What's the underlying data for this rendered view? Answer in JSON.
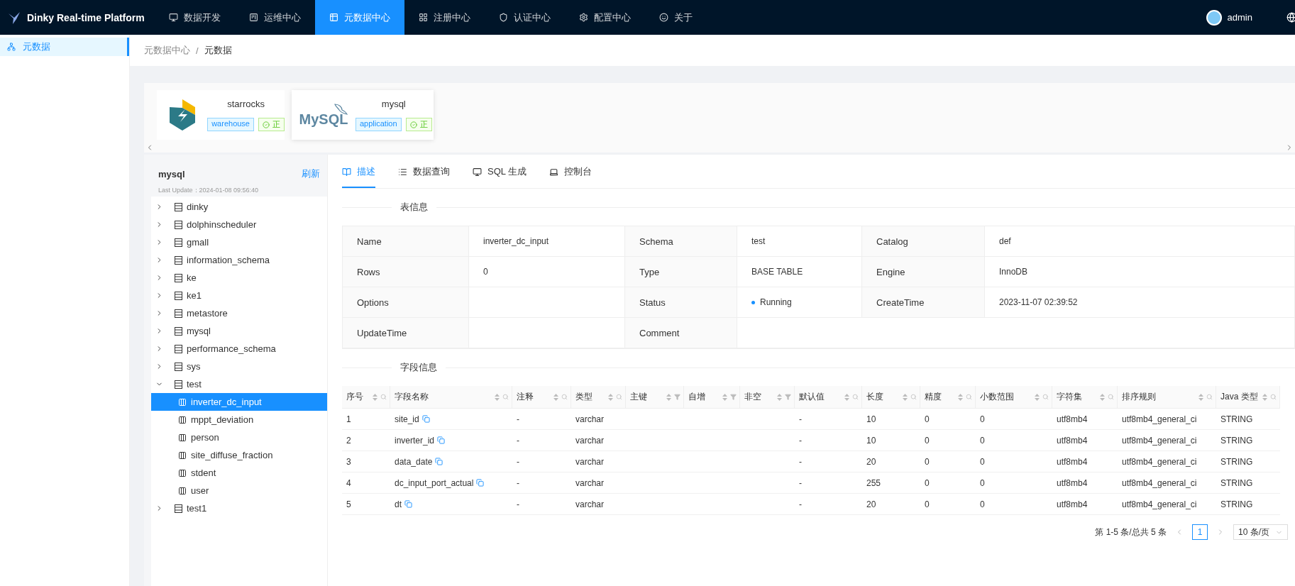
{
  "header": {
    "title": "Dinky Real-time Platform",
    "user": "admin",
    "nav": [
      {
        "label": "数据开发",
        "selected": false
      },
      {
        "label": "运维中心",
        "selected": false
      },
      {
        "label": "元数据中心",
        "selected": true
      },
      {
        "label": "注册中心",
        "selected": false
      },
      {
        "label": "认证中心",
        "selected": false
      },
      {
        "label": "配置中心",
        "selected": false
      },
      {
        "label": "关于",
        "selected": false
      }
    ]
  },
  "sidebar": {
    "items": [
      {
        "label": "元数据",
        "selected": true
      }
    ]
  },
  "breadcrumb": {
    "items": [
      "元数据中心",
      "元数据"
    ],
    "separator": "/"
  },
  "datasources": [
    {
      "name": "starrocks",
      "tag": "warehouse",
      "status": "正",
      "selected": false
    },
    {
      "name": "mysql",
      "logo_text": "MySQL",
      "tag": "application",
      "status": "正",
      "selected": true
    }
  ],
  "tree": {
    "title": "mysql",
    "refresh": "刷新",
    "last_update": "Last Update：2024-01-08 09:56:40",
    "items": [
      {
        "label": "dinky",
        "expanded": false
      },
      {
        "label": "dolphinscheduler",
        "expanded": false
      },
      {
        "label": "gmall",
        "expanded": false
      },
      {
        "label": "information_schema",
        "expanded": false
      },
      {
        "label": "ke",
        "expanded": false
      },
      {
        "label": "ke1",
        "expanded": false
      },
      {
        "label": "metastore",
        "expanded": false
      },
      {
        "label": "mysql",
        "expanded": false
      },
      {
        "label": "performance_schema",
        "expanded": false
      },
      {
        "label": "sys",
        "expanded": false
      },
      {
        "label": "test",
        "expanded": true,
        "children": [
          {
            "label": "inverter_dc_input",
            "selected": true
          },
          {
            "label": "mppt_deviation",
            "selected": false
          },
          {
            "label": "person",
            "selected": false
          },
          {
            "label": "site_diffuse_fraction",
            "selected": false
          },
          {
            "label": "stdent",
            "selected": false
          },
          {
            "label": "user",
            "selected": false
          }
        ]
      },
      {
        "label": "test1",
        "expanded": false
      }
    ]
  },
  "tabs": [
    {
      "label": "描述",
      "selected": true
    },
    {
      "label": "数据查询",
      "selected": false
    },
    {
      "label": "SQL 生成",
      "selected": false
    },
    {
      "label": "控制台",
      "selected": false
    }
  ],
  "table_info": {
    "title": "表信息",
    "rows": [
      [
        {
          "label": "Name",
          "value": "inverter_dc_input"
        },
        {
          "label": "Schema",
          "value": "test"
        },
        {
          "label": "Catalog",
          "value": "def"
        }
      ],
      [
        {
          "label": "Rows",
          "value": "0"
        },
        {
          "label": "Type",
          "value": "BASE TABLE"
        },
        {
          "label": "Engine",
          "value": "InnoDB"
        }
      ],
      [
        {
          "label": "Options"
        },
        {
          "label": "Status",
          "value": "Running",
          "kind": "status"
        },
        {
          "label": "CreateTime",
          "value": "2023-11-07 02:39:52"
        }
      ],
      [
        {
          "label": "UpdateTime"
        },
        {
          "label": "Comment"
        }
      ]
    ]
  },
  "fields": {
    "title": "字段信息",
    "columns": [
      {
        "label": "序号",
        "kind": "search"
      },
      {
        "label": "字段名称",
        "kind": "search"
      },
      {
        "label": "注释",
        "kind": "search"
      },
      {
        "label": "类型",
        "kind": "search"
      },
      {
        "label": "主键",
        "kind": "filter"
      },
      {
        "label": "自增",
        "kind": "filter"
      },
      {
        "label": "非空",
        "kind": "filter"
      },
      {
        "label": "默认值",
        "kind": "search"
      },
      {
        "label": "长度",
        "kind": "search"
      },
      {
        "label": "精度",
        "kind": "search"
      },
      {
        "label": "小数范围",
        "kind": "search"
      },
      {
        "label": "字符集",
        "kind": "search"
      },
      {
        "label": "排序规则",
        "kind": "search"
      },
      {
        "label": "Java 类型",
        "kind": "search"
      }
    ],
    "rows": [
      [
        "1",
        "site_id",
        "-",
        "varchar",
        null,
        null,
        null,
        "-",
        "10",
        "0",
        "0",
        "utf8mb4",
        "utf8mb4_general_ci",
        "STRING"
      ],
      [
        "2",
        "inverter_id",
        "-",
        "varchar",
        null,
        null,
        null,
        "-",
        "10",
        "0",
        "0",
        "utf8mb4",
        "utf8mb4_general_ci",
        "STRING"
      ],
      [
        "3",
        "data_date",
        "-",
        "varchar",
        null,
        null,
        null,
        "-",
        "20",
        "0",
        "0",
        "utf8mb4",
        "utf8mb4_general_ci",
        "STRING"
      ],
      [
        "4",
        "dc_input_port_actual",
        "-",
        "varchar",
        null,
        null,
        null,
        "-",
        "255",
        "0",
        "0",
        "utf8mb4",
        "utf8mb4_general_ci",
        "STRING"
      ],
      [
        "5",
        "dt",
        "-",
        "varchar",
        null,
        null,
        null,
        "-",
        "20",
        "0",
        "0",
        "utf8mb4",
        "utf8mb4_general_ci",
        "STRING"
      ]
    ]
  },
  "pagination": {
    "summary": "第 1-5 条/总共 5 条",
    "pages": [
      {
        "label": "1",
        "selected": true
      }
    ],
    "page_size": "10 条/页"
  }
}
